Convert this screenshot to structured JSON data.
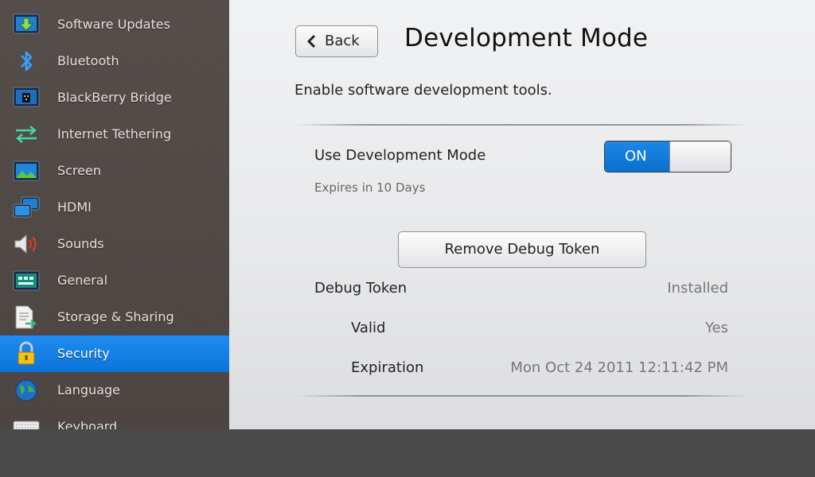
{
  "sidebar": {
    "items": [
      {
        "label": "Software Updates",
        "icon": "download-icon"
      },
      {
        "label": "Bluetooth",
        "icon": "bluetooth-icon"
      },
      {
        "label": "BlackBerry Bridge",
        "icon": "blackberry-bridge-icon"
      },
      {
        "label": "Internet Tethering",
        "icon": "tethering-arrows-icon"
      },
      {
        "label": "Screen",
        "icon": "screen-icon"
      },
      {
        "label": "HDMI",
        "icon": "hdmi-icon"
      },
      {
        "label": "Sounds",
        "icon": "speaker-icon"
      },
      {
        "label": "General",
        "icon": "general-board-icon"
      },
      {
        "label": "Storage & Sharing",
        "icon": "storage-document-icon"
      },
      {
        "label": "Security",
        "icon": "lock-icon",
        "active": true
      },
      {
        "label": "Language",
        "icon": "globe-icon"
      },
      {
        "label": "Keyboard",
        "icon": "keyboard-icon"
      }
    ]
  },
  "header": {
    "back_label": "Back",
    "title": "Development Mode"
  },
  "main": {
    "description": "Enable software development tools.",
    "dev_mode": {
      "label": "Use Development Mode",
      "toggle_state": "ON",
      "expires_note": "Expires in 10 Days"
    },
    "remove_button_label": "Remove Debug Token",
    "debug_token": {
      "label": "Debug Token",
      "value": "Installed",
      "valid_label": "Valid",
      "valid_value": "Yes",
      "expiration_label": "Expiration",
      "expiration_value": "Mon Oct 24 2011 12:11:42 PM"
    }
  },
  "colors": {
    "accent": "#0b73d8",
    "sidebar_bg": "#4f4845",
    "content_bg": "#eceef0"
  }
}
